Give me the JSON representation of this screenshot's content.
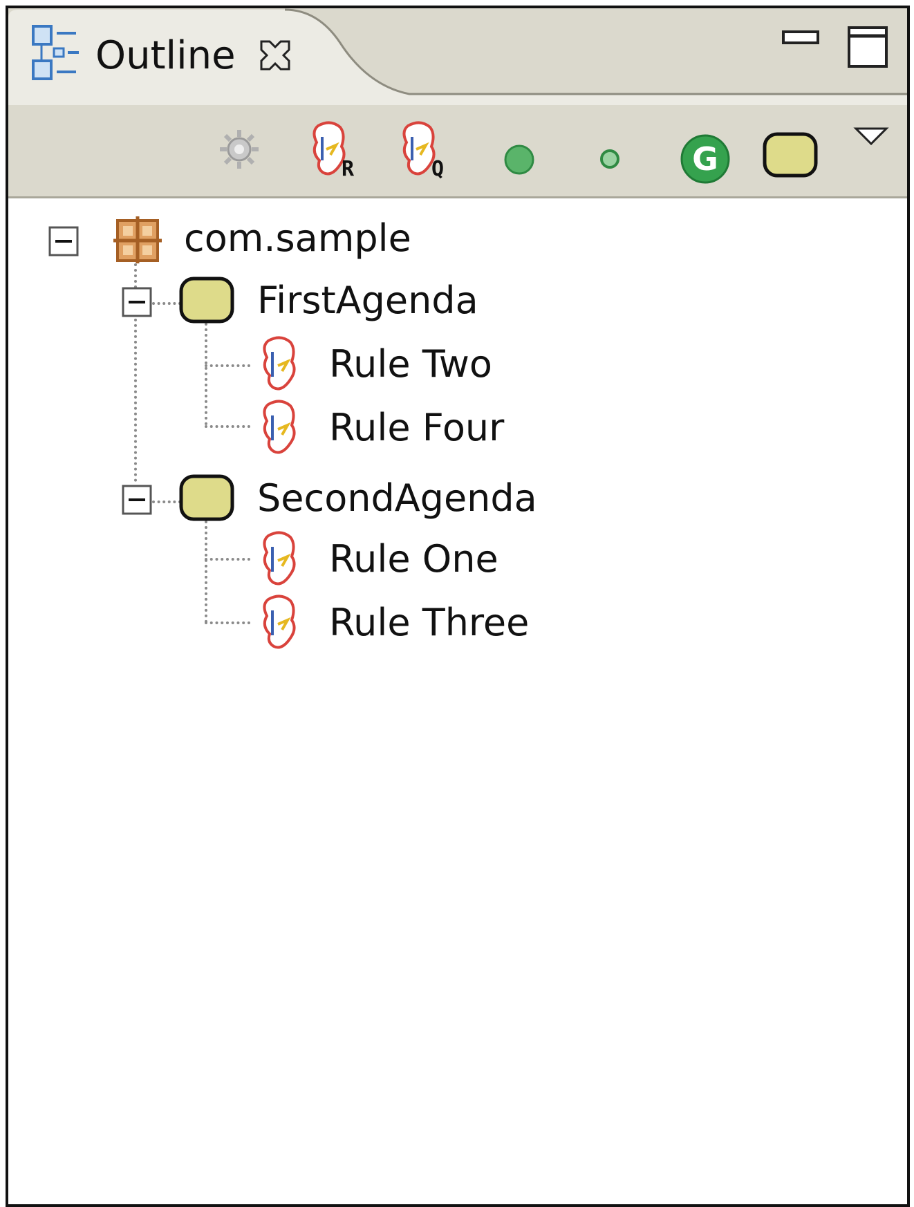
{
  "window": {
    "tab_title": "Outline",
    "colors": {
      "header_bg": "#dbd9cd",
      "agenda_fill": "#dedb8a",
      "rule_outline": "#d9433c",
      "green": "#3aa35a"
    }
  },
  "toolbar": {
    "items": [
      {
        "icon": "gear-disabled-icon"
      },
      {
        "icon": "rule-r-icon",
        "badge": "R"
      },
      {
        "icon": "rule-q-icon",
        "badge": "Q"
      },
      {
        "icon": "large-green-dot-icon"
      },
      {
        "icon": "small-green-dot-icon"
      },
      {
        "icon": "global-g-icon",
        "badge": "G"
      },
      {
        "icon": "agenda-icon"
      },
      {
        "icon": "view-menu-chevron-icon"
      }
    ]
  },
  "tree": {
    "package": {
      "label": "com.sample",
      "icon": "package-icon",
      "expanded": true
    },
    "agendas": [
      {
        "label": "FirstAgenda",
        "expanded": true,
        "rules": [
          "Rule Two",
          "Rule Four"
        ]
      },
      {
        "label": "SecondAgenda",
        "expanded": true,
        "rules": [
          "Rule One",
          "Rule Three"
        ]
      }
    ]
  }
}
